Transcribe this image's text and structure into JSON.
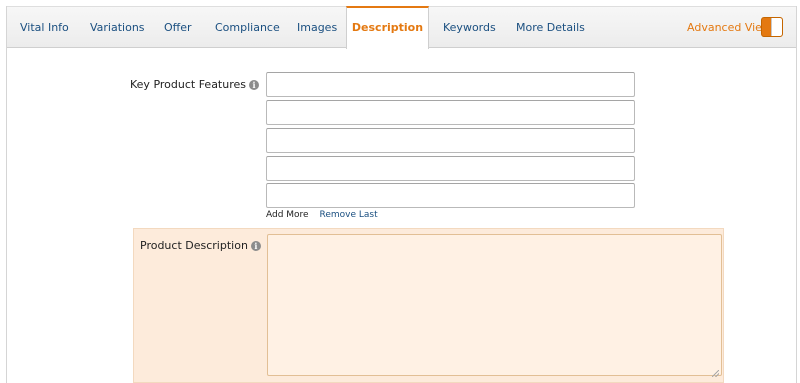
{
  "tabs": [
    {
      "label": "Vital Info",
      "active": false
    },
    {
      "label": "Variations",
      "active": false
    },
    {
      "label": "Offer",
      "active": false
    },
    {
      "label": "Compliance",
      "active": false
    },
    {
      "label": "Images",
      "active": false
    },
    {
      "label": "Description",
      "active": true
    },
    {
      "label": "Keywords",
      "active": false
    },
    {
      "label": "More Details",
      "active": false
    }
  ],
  "advanced_view": {
    "label": "Advanced View",
    "enabled": true
  },
  "form": {
    "key_features": {
      "label": "Key Product Features",
      "info_icon": "info-icon",
      "values": [
        "",
        "",
        "",
        "",
        ""
      ]
    },
    "add_more_label": "Add More",
    "remove_last_label": "Remove Last",
    "product_description": {
      "label": "Product Description",
      "info_icon": "info-icon",
      "value": ""
    }
  },
  "colors": {
    "accent": "#e47911",
    "link": "#1a4f80",
    "highlight_panel": "#fdebdb"
  }
}
